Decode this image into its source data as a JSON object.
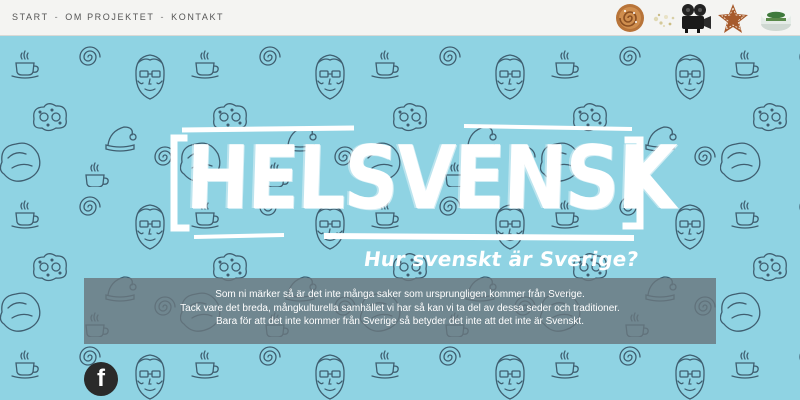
{
  "nav": {
    "items": [
      {
        "label": "START"
      },
      {
        "label": "OM PROJEKTET"
      },
      {
        "label": "KONTAKT"
      }
    ],
    "separator": "-"
  },
  "thumbnails": [
    {
      "icon": "cinnamon-bun-thumb"
    },
    {
      "icon": "crumbs-thumb"
    },
    {
      "icon": "film-camera-thumb"
    },
    {
      "icon": "gingerbread-star-thumb"
    },
    {
      "icon": "snus-tin-thumb"
    }
  ],
  "hero": {
    "logo_text": "HELSVENSK",
    "subtitle": "Hur svenskt är Sverige?",
    "intro": [
      "Som ni märker så är det inte många saker som ursprungligen kommer från Sverige.",
      "Tack vare det breda, mångkulturella samhället vi har så kan vi ta del av dessa seder och traditioner.",
      "Bara för att det inte kommer från Sverige så betyder det inte att det inte är Svenskt."
    ]
  },
  "social": {
    "facebook_glyph": "f"
  },
  "colors": {
    "background": "#8fd3e3",
    "pattern_ink": "#3f5e70",
    "topbar": "#f4f4f2",
    "intro_box": "#69767e"
  }
}
